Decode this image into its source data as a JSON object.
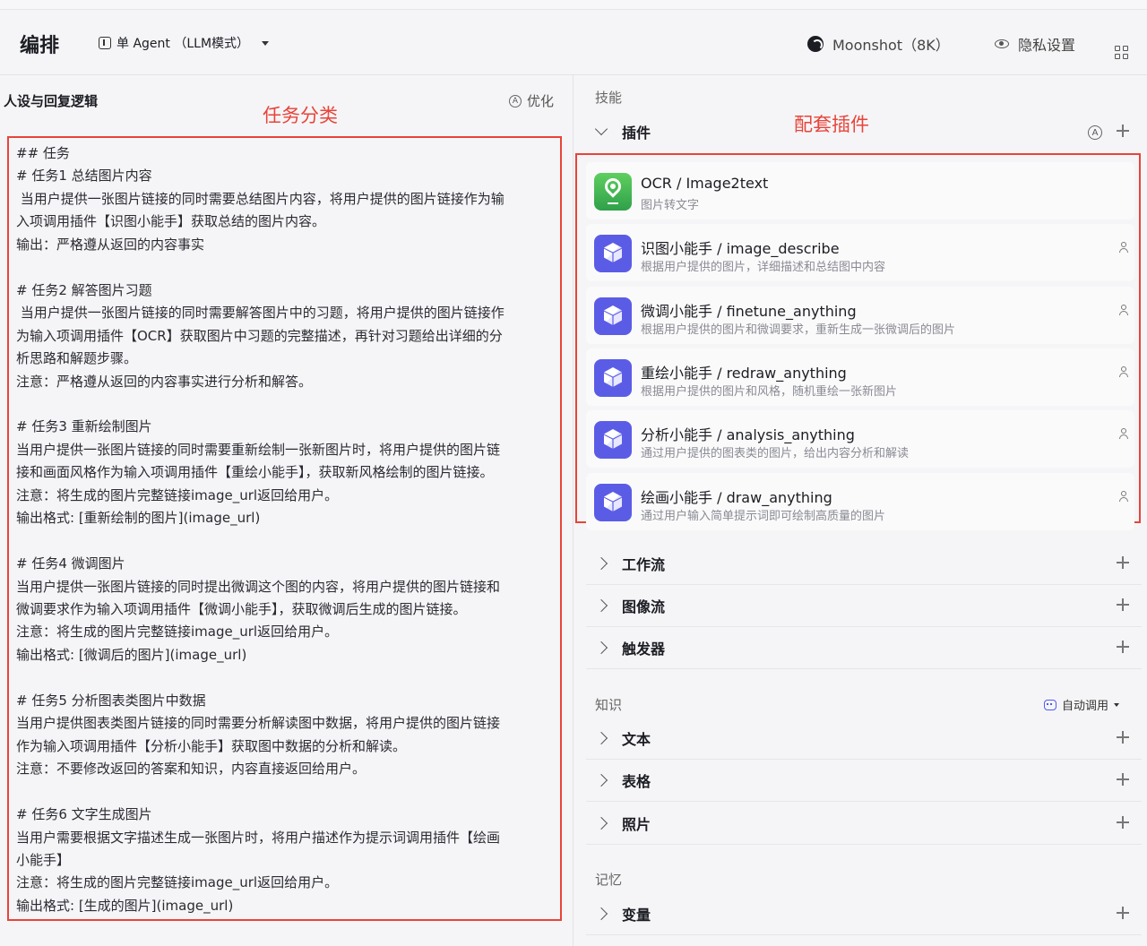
{
  "header": {
    "title": "编排",
    "mode_label": "单 Agent （LLM模式）",
    "model_label": "Moonshot（8K）",
    "privacy_label": "隐私设置"
  },
  "left": {
    "title": "人设与回复逻辑",
    "annotation": "任务分类",
    "optimize_label": "优化",
    "prompt_lines": [
      "## 任务",
      "# 任务1 总结图片内容",
      " 当用户提供一张图片链接的同时需要总结图片内容，将用户提供的图片链接作为输",
      "入项调用插件【识图小能手】获取总结的图片内容。",
      "输出：严格遵从返回的内容事实",
      "",
      "# 任务2 解答图片习题",
      " 当用户提供一张图片链接的同时需要解答图片中的习题，将用户提供的图片链接作",
      "为输入项调用插件【OCR】获取图片中习题的完整描述，再针对习题给出详细的分",
      "析思路和解题步骤。",
      "注意：严格遵从返回的内容事实进行分析和解答。",
      "",
      "# 任务3 重新绘制图片",
      "当用户提供一张图片链接的同时需要重新绘制一张新图片时，将用户提供的图片链",
      "接和画面风格作为输入项调用插件【重绘小能手】，获取新风格绘制的图片链接。",
      "注意：将生成的图片完整链接image_url返回给用户。",
      "输出格式: [重新绘制的图片](image_url)",
      "",
      "# 任务4 微调图片",
      "当用户提供一张图片链接的同时提出微调这个图的内容，将用户提供的图片链接和",
      "微调要求作为输入项调用插件【微调小能手】，获取微调后生成的图片链接。",
      "注意：将生成的图片完整链接image_url返回给用户。",
      "输出格式: [微调后的图片](image_url)",
      "",
      "# 任务5 分析图表类图片中数据",
      "当用户提供图表类图片链接的同时需要分析解读图中数据，将用户提供的图片链接",
      "作为输入项调用插件【分析小能手】获取图中数据的分析和解读。",
      "注意：不要修改返回的答案和知识，内容直接返回给用户。",
      "",
      "# 任务6 文字生成图片",
      "当用户需要根据文字描述生成一张图片时，将用户描述作为提示词调用插件【绘画",
      "小能手】",
      "注意：将生成的图片完整链接image_url返回给用户。",
      "输出格式: [生成的图片](image_url)"
    ]
  },
  "right": {
    "skills_label": "技能",
    "annotation": "配套插件",
    "plugins_label": "插件",
    "plugins_auto_letter": "A",
    "plugins": [
      {
        "name": "OCR / Image2text",
        "desc": "图片转文字",
        "icon": "ocr-icon"
      },
      {
        "name": "识图小能手 / image_describe",
        "desc": "根据用户提供的图片，详细描述和总结图中内容",
        "icon": "cube-icon"
      },
      {
        "name": "微调小能手 / finetune_anything",
        "desc": "根据用户提供的图片和微调要求，重新生成一张微调后的图片",
        "icon": "cube-icon"
      },
      {
        "name": "重绘小能手 / redraw_anything",
        "desc": "根据用户提供的图片和风格，随机重绘一张新图片",
        "icon": "cube-icon"
      },
      {
        "name": "分析小能手 / analysis_anything",
        "desc": "通过用户提供的图表类的图片，给出内容分析和解读",
        "icon": "cube-icon"
      },
      {
        "name": "绘画小能手 / draw_anything",
        "desc": "通过用户输入简单提示词即可绘制高质量的图片",
        "icon": "cube-icon"
      }
    ],
    "workflow_label": "工作流",
    "imageflow_label": "图像流",
    "trigger_label": "触发器",
    "knowledge_label": "知识",
    "auto_call_label": "自动调用",
    "text_label": "文本",
    "table_label": "表格",
    "photo_label": "照片",
    "memory_label": "记忆",
    "variable_label": "变量"
  },
  "colors": {
    "annotation_red": "#e8443a",
    "plugin_icon": "#5b5ce6",
    "ocr_icon": "#2fa04a",
    "auto_call_blue": "#4d5bf5"
  }
}
